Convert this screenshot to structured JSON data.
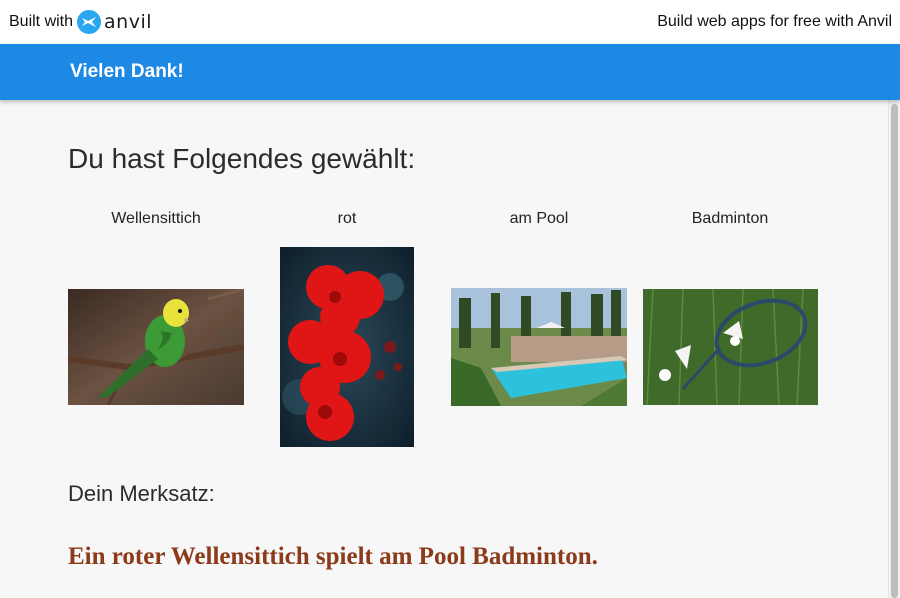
{
  "banner": {
    "built_with": "Built with",
    "brand": "anvil",
    "free_link": "Build web apps for free with Anvil"
  },
  "app_bar": {
    "title": "Vielen Dank!"
  },
  "main": {
    "heading": "Du hast Folgendes gewählt:",
    "choices": [
      {
        "label": "Wellensittich",
        "image": "budgie-photo"
      },
      {
        "label": "rot",
        "image": "red-flower-photo"
      },
      {
        "label": "am Pool",
        "image": "pool-photo"
      },
      {
        "label": "Badminton",
        "image": "badminton-photo"
      }
    ],
    "motto_heading": "Dein Merksatz:",
    "motto": "Ein roter Wellensittich spielt am Pool Badminton."
  },
  "colors": {
    "app_bar": "#1e88e5",
    "motto_text": "#8b3a1a",
    "background": "#f7f7f7"
  }
}
